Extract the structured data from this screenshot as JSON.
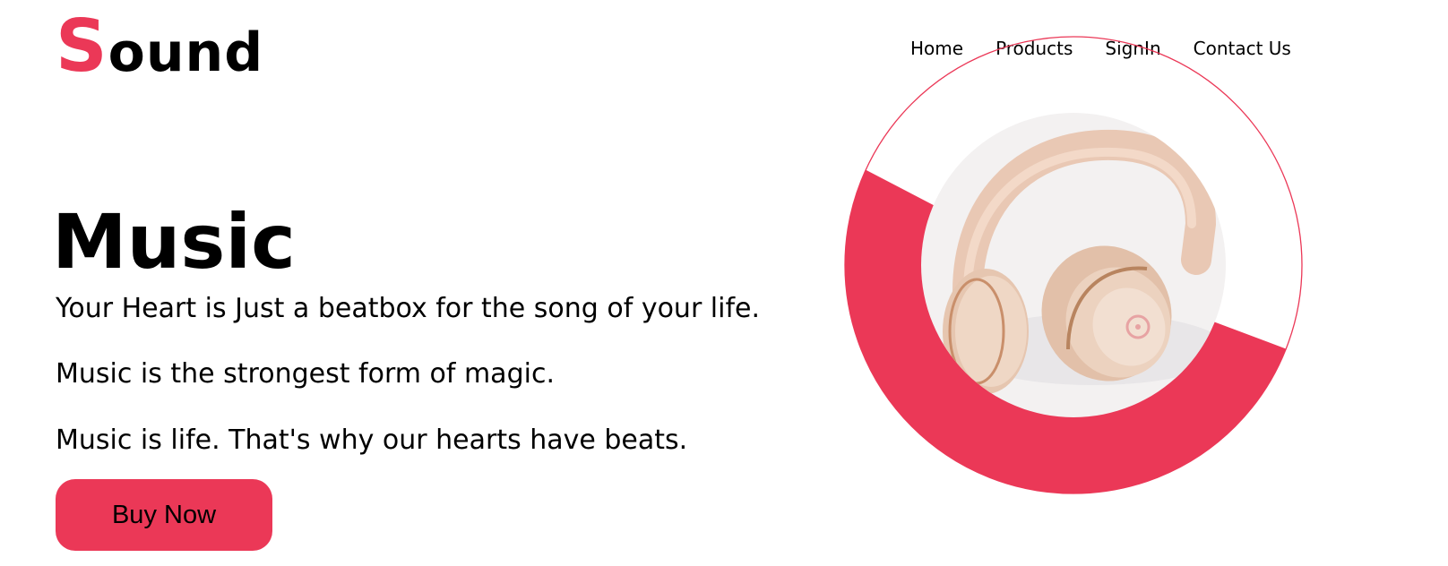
{
  "header": {
    "logo": {
      "first_letter": "S",
      "rest": "ound"
    },
    "nav": [
      "Home",
      "Products",
      "SignIn",
      "Contact Us"
    ]
  },
  "hero": {
    "title": "Music",
    "taglines": [
      "Your Heart is Just a beatbox for the song of your life.",
      "Music is the strongest form of magic.",
      "Music is life. That's why our hearts have beats."
    ],
    "cta_label": "Buy Now"
  },
  "colors": {
    "accent": "#eb3857",
    "text": "#000000",
    "background": "#ffffff"
  },
  "icons": {
    "product_image": "headphones-icon"
  }
}
